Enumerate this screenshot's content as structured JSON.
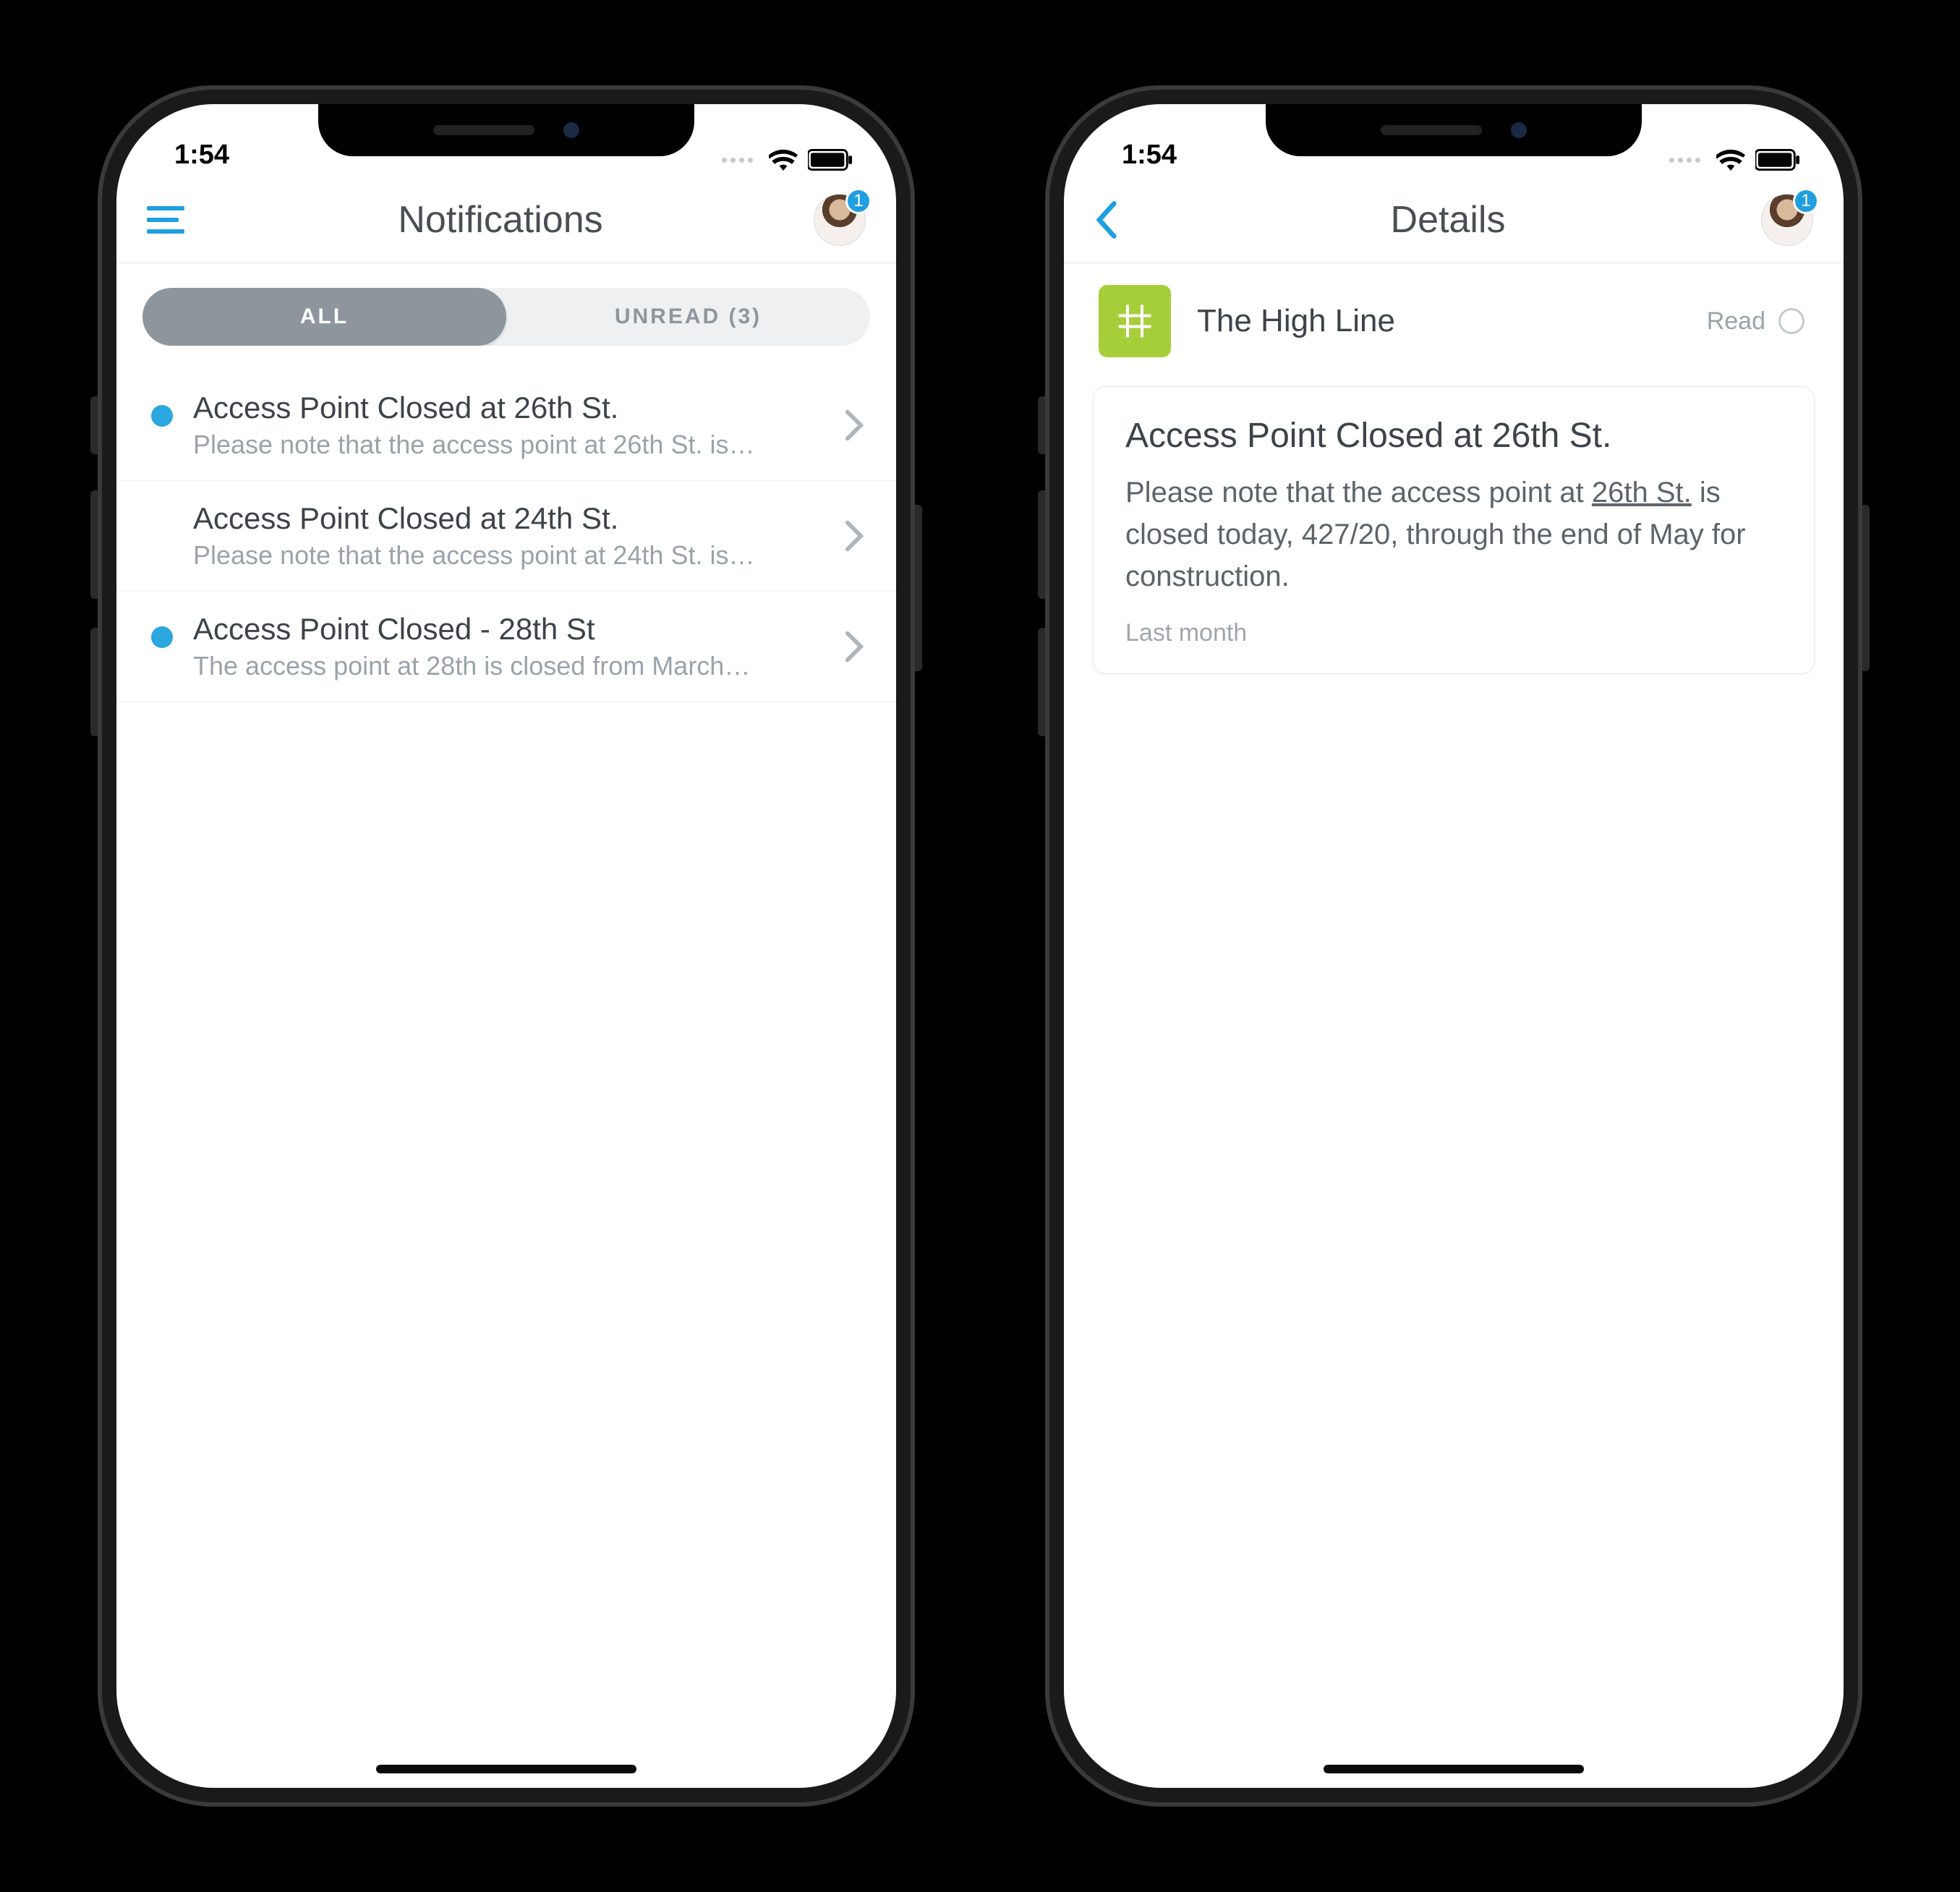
{
  "status": {
    "time": "1:54"
  },
  "avatar_badge": "1",
  "screen_left": {
    "header": {
      "title": "Notifications"
    },
    "tabs": {
      "all": "ALL",
      "unread": "UNREAD (3)"
    },
    "items": [
      {
        "title": "Access Point Closed at 26th St.",
        "subtitle": "Please note that the access point at 26th St. is…",
        "unread": true
      },
      {
        "title": "Access Point Closed at 24th St.",
        "subtitle": "Please note that the access point at 24th St. is…",
        "unread": false
      },
      {
        "title": "Access Point Closed - 28th St",
        "subtitle": "The access point at 28th is closed from March…",
        "unread": true
      }
    ]
  },
  "screen_right": {
    "header": {
      "title": "Details"
    },
    "org": {
      "name": "The High Line",
      "read_label": "Read"
    },
    "detail": {
      "title": "Access Point Closed at 26th St.",
      "body_pre": "Please note that the access point at ",
      "body_link": "26th St.",
      "body_post": " is closed today, 427/20, through the end of May for construction.",
      "timestamp": "Last month"
    }
  }
}
